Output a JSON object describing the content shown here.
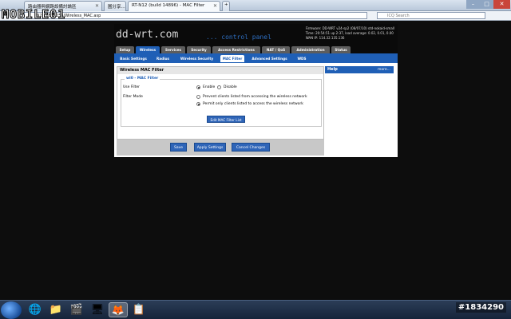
{
  "browser": {
    "tabs": [
      {
        "label": "路由器與網路設備討論區"
      },
      {
        "label": "圖分享..."
      },
      {
        "label": "RT-N12 (build 14896) - MAC Filter"
      }
    ],
    "url": "192.168.1.254/Wireless_MAC.asp",
    "search_placeholder": "ICQ Search"
  },
  "watermark": {
    "logo": "MOBILE01",
    "id": "#1834290"
  },
  "router": {
    "brand": "dd-wrt.com",
    "brand_sub": "... control panel",
    "firmware": "Firmware: DD-WRT v24-sp2 (08/07/10) std-nokaid-small",
    "time": "Time: 20:54:51 up 2:37, load average: 0.02, 0.01, 0.00",
    "wan_ip": "WAN IP: 114.32.135.136",
    "main_tabs": [
      "Setup",
      "Wireless",
      "Services",
      "Security",
      "Access Restrictions",
      "NAT / QoS",
      "Administration",
      "Status"
    ],
    "active_main_tab": "Wireless",
    "sub_tabs": [
      "Basic Settings",
      "Radius",
      "Wireless Security",
      "MAC Filter",
      "Advanced Settings",
      "WDS"
    ],
    "active_sub_tab": "MAC Filter",
    "panel_title": "Wireless MAC Filter",
    "section_legend": "wl0 - MAC Filter",
    "use_filter_label": "Use Filter",
    "enable_label": "Enable",
    "disable_label": "Disable",
    "filter_mode_label": "Filter Mode",
    "prevent_label": "Prevent clients listed from accessing the wireless network",
    "permit_label": "Permit only clients listed to access the wireless network",
    "edit_button": "Edit MAC Filter List",
    "help_title": "Help",
    "help_more": "more...",
    "save_button": "Save",
    "apply_button": "Apply Settings",
    "cancel_button": "Cancel Changes"
  },
  "colors": {
    "accent": "#1f5fb6",
    "header_bg": "#0a0a0a",
    "tab_grey": "#5d5d5d"
  }
}
